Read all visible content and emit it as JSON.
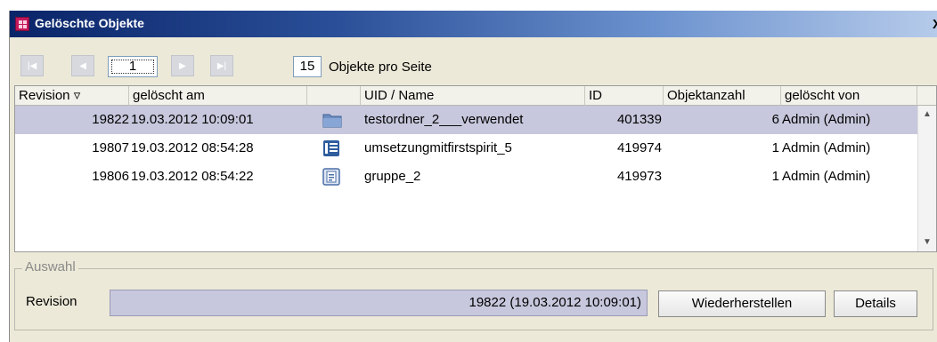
{
  "window": {
    "title": "Gelöschte Objekte",
    "close_label": "X"
  },
  "pager": {
    "current_page": "1",
    "per_page": "15",
    "per_page_label": "Objekte pro Seite"
  },
  "table": {
    "headers": [
      "Revision ▿",
      "gelöscht am",
      "",
      "UID / Name",
      "ID",
      "Objektanzahl",
      "gelöscht von"
    ],
    "rows": [
      {
        "revision": "19822",
        "deleted_at": "19.03.2012 10:09:01",
        "icon": "folder-icon",
        "name": "testordner_2___verwendet",
        "id": "401339",
        "count": "6",
        "deleted_by": "Admin (Admin)",
        "selected": true
      },
      {
        "revision": "19807",
        "deleted_at": "19.03.2012 08:54:28",
        "icon": "page-reference-icon",
        "name": "umsetzungmitfirstspirit_5",
        "id": "419974",
        "count": "1",
        "deleted_by": "Admin (Admin)",
        "selected": false
      },
      {
        "revision": "19806",
        "deleted_at": "19.03.2012 08:54:22",
        "icon": "document-icon",
        "name": "gruppe_2",
        "id": "419973",
        "count": "1",
        "deleted_by": "Admin (Admin)",
        "selected": false
      }
    ]
  },
  "selection": {
    "group_label": "Auswahl",
    "revision_label": "Revision",
    "revision_value": "19822 (19.03.2012 10:09:01)",
    "restore_label": "Wiederherstellen",
    "details_label": "Details"
  },
  "colors": {
    "selected_row": "#c7c8dd",
    "dialog_bg": "#ece9d8",
    "title_dark": "#0a2468"
  }
}
